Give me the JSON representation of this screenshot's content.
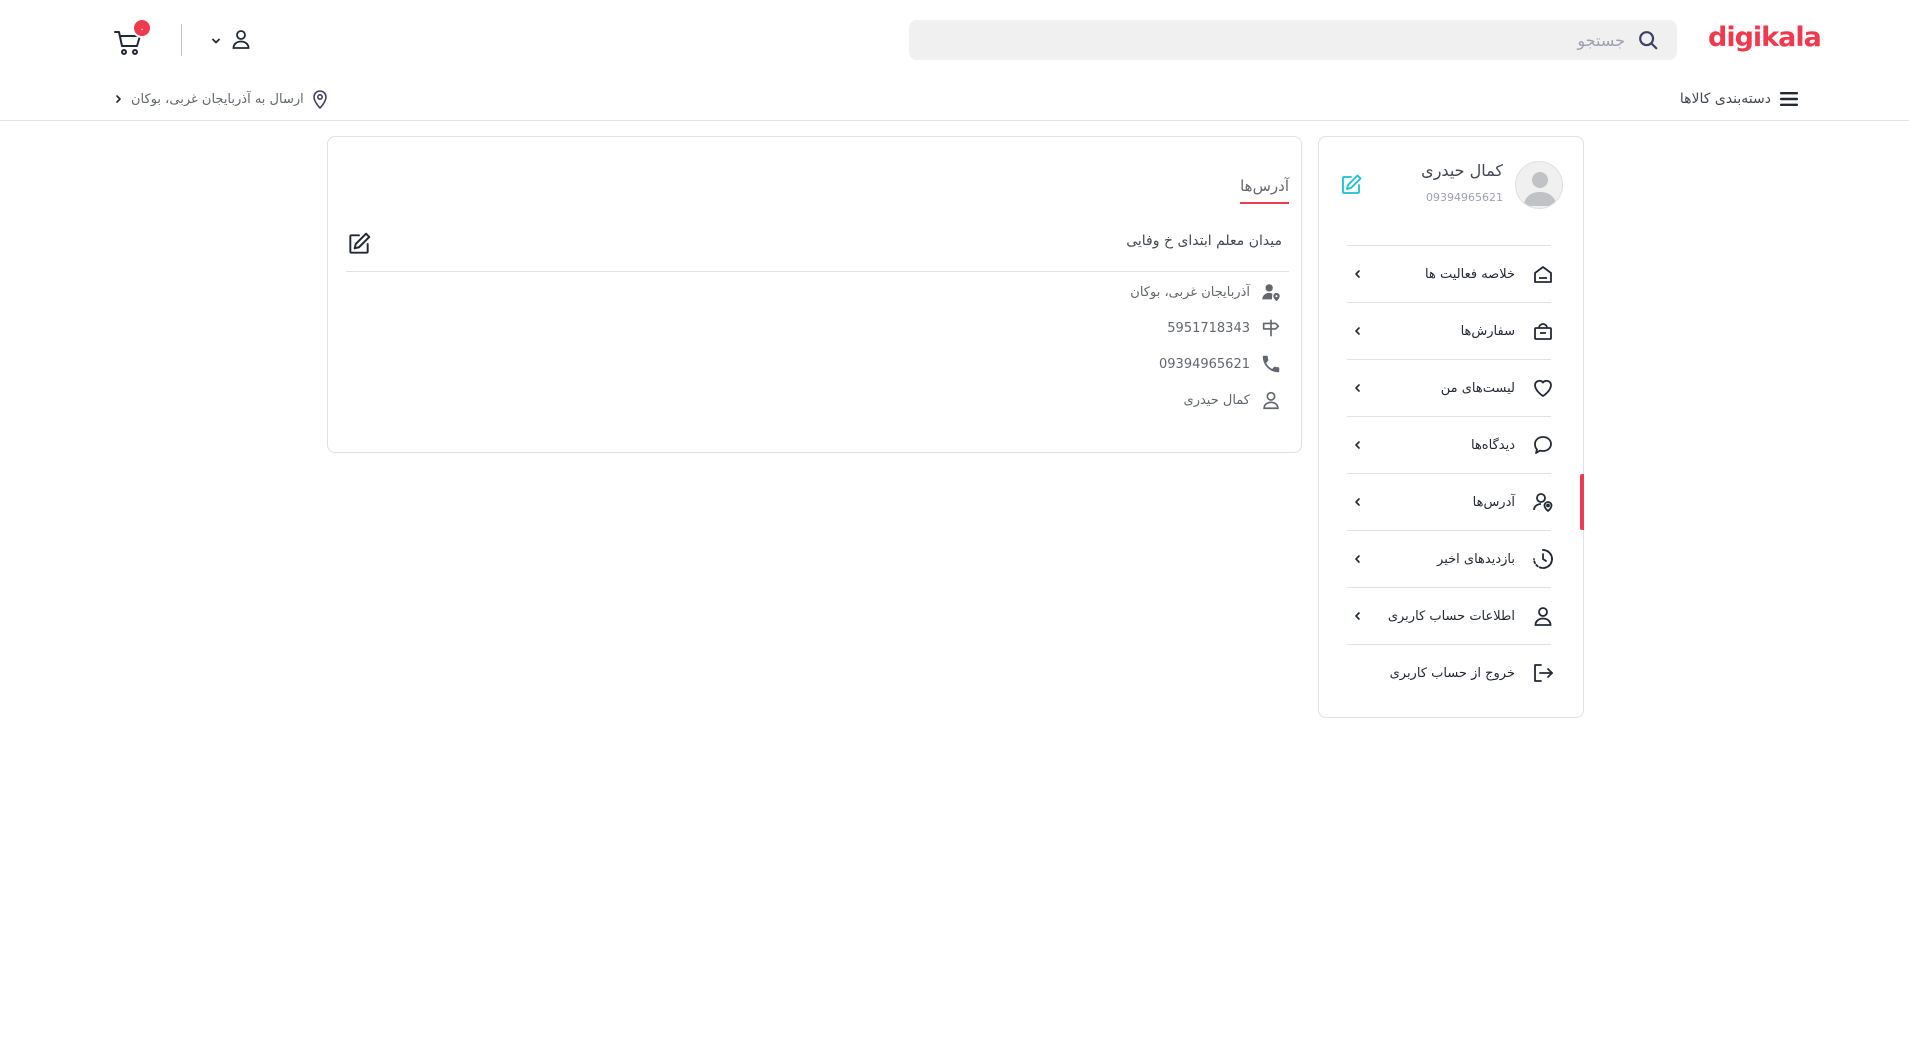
{
  "header": {
    "logo_text": "digikala",
    "search": {
      "placeholder": "جستجو",
      "value": ""
    },
    "cart": {
      "badge_count": "۰"
    },
    "categories_label": "دسته‌بندی کالاها",
    "ship_to_label": "ارسال به آذربایجان غربی، بوکان"
  },
  "profile": {
    "name": "کمال حیدری",
    "phone": "09394965621"
  },
  "sidebar": {
    "items": [
      {
        "label": "خلاصه فعالیت ها",
        "icon": "home-icon",
        "has_chevron": true
      },
      {
        "label": "سفارش‌ها",
        "icon": "bag-icon",
        "has_chevron": true
      },
      {
        "label": "لیست‌های من",
        "icon": "heart-icon",
        "has_chevron": true
      },
      {
        "label": "دیدگاه‌ها",
        "icon": "comment-icon",
        "has_chevron": true
      },
      {
        "label": "آدرس‌ها",
        "icon": "location-user-icon",
        "has_chevron": true,
        "active": true
      },
      {
        "label": "بازدیدهای اخیر",
        "icon": "history-icon",
        "has_chevron": true
      },
      {
        "label": "اطلاعات حساب کاربری",
        "icon": "user-icon",
        "has_chevron": true
      },
      {
        "label": "خروج از حساب کاربری",
        "icon": "logout-icon",
        "has_chevron": false
      }
    ]
  },
  "main": {
    "tab_title": "آدرس‌ها",
    "address": {
      "line": "میدان معلم ابتدای خ وفایی",
      "region": "آذربایجان غربی، بوکان",
      "postal_code": "5951718343",
      "phone": "09394965621",
      "recipient": "کمال حیدری"
    }
  },
  "colors": {
    "brand": "#ef394e",
    "text_primary": "#232933",
    "text_secondary": "#62666d",
    "border": "#e0e0e6",
    "edit_icon": "#19bfd3"
  }
}
